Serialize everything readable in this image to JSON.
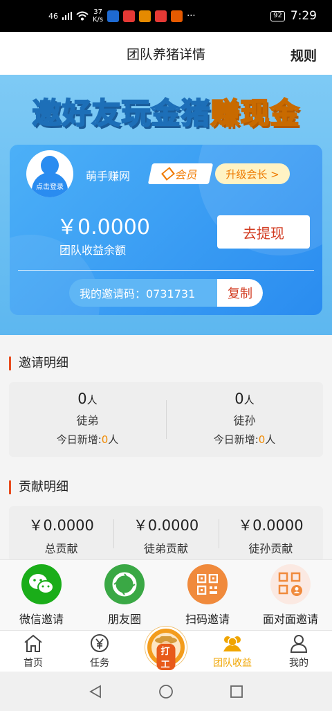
{
  "status_bar": {
    "signal": "46",
    "speed_value": "37",
    "speed_unit": "K/s",
    "more": "···",
    "battery": "92",
    "time": "7:29",
    "app_colors": [
      "#1e6ad2",
      "#e53935",
      "#e58a00",
      "#e53935",
      "#e65a00"
    ]
  },
  "header": {
    "title": "团队养猪详情",
    "rules_label": "规则"
  },
  "banner": {
    "white_text": "邀好友玩金猪",
    "yellow_text": "赚现金"
  },
  "user": {
    "avatar_login_text": "点击登录",
    "name": "萌手赚网",
    "vip_label": "会员",
    "upgrade_label": "升级会长 >"
  },
  "balance": {
    "amount": "￥0.0000",
    "label": "团队收益余额",
    "withdraw_label": "去提现"
  },
  "invite": {
    "code_label": "我的邀请码：0731731",
    "copy_label": "复制"
  },
  "invite_detail": {
    "title": "邀请明细",
    "columns": [
      {
        "count": "0",
        "unit": "人",
        "label": "徒弟",
        "today_prefix": "今日新增:",
        "today_value": "0",
        "today_unit": "人"
      },
      {
        "count": "0",
        "unit": "人",
        "label": "徒孙",
        "today_prefix": "今日新增:",
        "today_value": "0",
        "today_unit": "人"
      }
    ]
  },
  "contribution_detail": {
    "title": "贡献明细",
    "columns": [
      {
        "amount": "￥0.0000",
        "label": "总贡献"
      },
      {
        "amount": "￥0.0000",
        "label": "徒弟贡献"
      },
      {
        "amount": "￥0.0000",
        "label": "徒孙贡献"
      }
    ]
  },
  "share": {
    "items": [
      {
        "label": "微信邀请",
        "icon": "wechat-icon",
        "color": "#1aad19"
      },
      {
        "label": "朋友圈",
        "icon": "moments-icon",
        "color": "#3aa845"
      },
      {
        "label": "扫码邀请",
        "icon": "qrcode-icon",
        "color": "#f08a3c"
      },
      {
        "label": "面对面邀请",
        "icon": "face-to-face-icon",
        "color": "#fbe9e2"
      }
    ]
  },
  "tabbar": {
    "items": [
      {
        "label": "首页",
        "icon": "home-icon"
      },
      {
        "label": "任务",
        "icon": "yen-coin-icon"
      },
      {
        "label": "打工",
        "icon": "worker-icon"
      },
      {
        "label": "团队收益",
        "icon": "team-icon",
        "active": true
      },
      {
        "label": "我的",
        "icon": "person-icon"
      }
    ]
  },
  "colors": {
    "accent_orange": "#f0a500",
    "section_marker": "#e84c1f",
    "withdraw_text": "#d23a1f"
  }
}
